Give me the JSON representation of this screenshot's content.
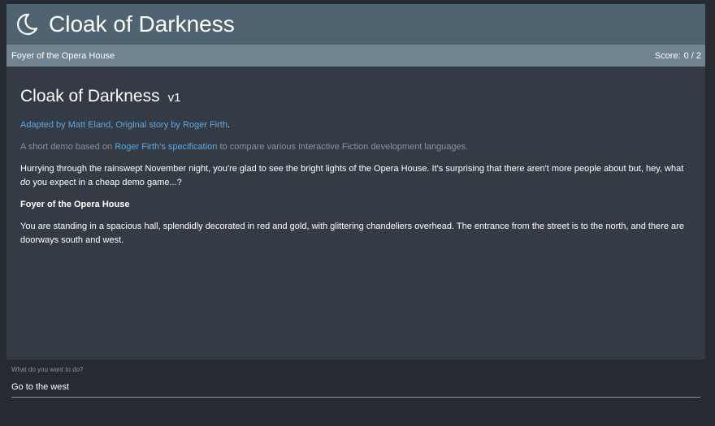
{
  "header": {
    "title": "Cloak of Darkness",
    "logo_icon": "moon-icon"
  },
  "status": {
    "location": "Foyer of the Opera House",
    "score_label": "Score:",
    "score_value": "0 / 2"
  },
  "story": {
    "title": "Cloak of Darkness",
    "version": "v1",
    "credits": {
      "adapted_by": "Adapted by Matt Eland",
      "separator": ",",
      "original_by": "Original story by Roger Firth",
      "end": "."
    },
    "intro": {
      "before": "A short demo based on",
      "link": "Roger Firth's specification",
      "after": "to compare various Interactive Fiction development languages."
    },
    "opening": {
      "before": "Hurrying through the rainswept November night, you're glad to see the bright lights of the Opera House. It's surprising that there aren't more people about but, hey, what",
      "emph": "do",
      "after": "you expect in a cheap demo game...?"
    },
    "room_name": "Foyer of the Opera House",
    "room_description": "You are standing in a spacious hall, splendidly decorated in red and gold, with glittering chandeliers overhead. The entrance from the street is to the north, and there are doorways south and west."
  },
  "command": {
    "label": "What do you want to do?",
    "value": "Go to the west"
  },
  "colors": {
    "background": "#262a31",
    "header": "#4f6370",
    "statusbar": "#6f8391",
    "story_panel": "#353b45",
    "link": "#5aa9e6",
    "muted_text": "#8a939e"
  }
}
